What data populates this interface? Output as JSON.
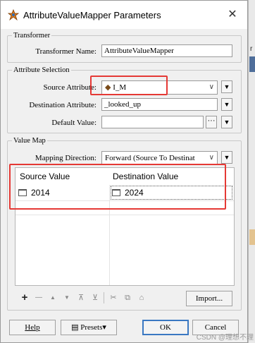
{
  "window": {
    "title": "AttributeValueMapper Parameters",
    "close_glyph": "✕"
  },
  "background": {
    "fragment": "r"
  },
  "transformer": {
    "legend": "Transformer",
    "name_label": "Transformer Name:",
    "name_value": "AttributeValueMapper"
  },
  "attribute_selection": {
    "legend": "Attribute Selection",
    "source_label": "Source Attribute:",
    "source_value": "I_M",
    "destination_label": "Destination Attribute:",
    "destination_value": "_looked_up",
    "default_label": "Default Value:",
    "default_value": ""
  },
  "value_map": {
    "legend": "Value Map",
    "direction_label": "Mapping Direction:",
    "direction_value": "Forward (Source To Destinat",
    "columns": [
      "Source Value",
      "Destination Value"
    ],
    "rows": [
      {
        "source": "2014",
        "destination": "2024"
      }
    ]
  },
  "toolbar": {
    "add": "+",
    "remove": "—",
    "up": "▲",
    "down": "▼",
    "top": "⊼",
    "bottom": "⊻",
    "cut": "✂",
    "copy": "⧉",
    "paste": "⌂",
    "import_label": "Import..."
  },
  "footer": {
    "help_label": "Help",
    "presets_label": "Presets▾",
    "ok_label": "OK",
    "cancel_label": "Cancel"
  },
  "watermark": "CSDN @理想不理"
}
